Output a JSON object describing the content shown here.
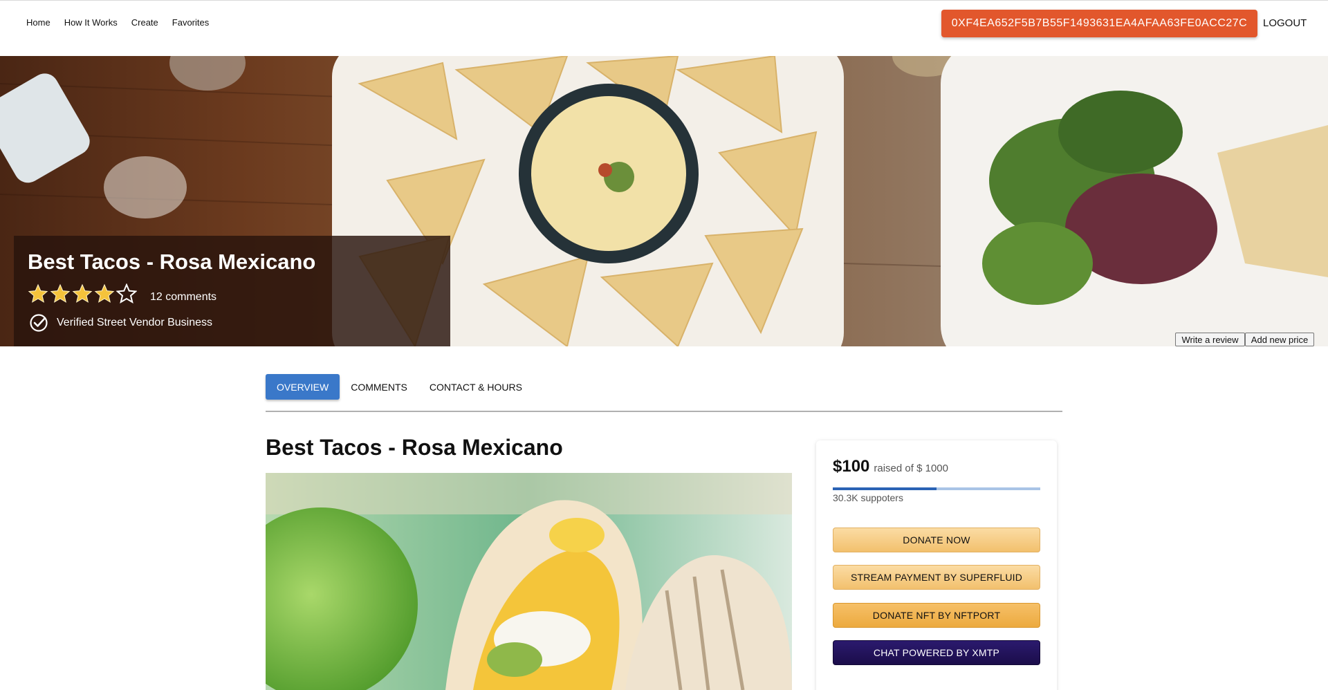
{
  "nav": {
    "links": [
      "Home",
      "How It Works",
      "Create",
      "Favorites"
    ],
    "wallet_address": "0XF4EA652F5B7B55F1493631EA4AFAA63FE0ACC27C",
    "logout_label": "LOGOUT"
  },
  "hero": {
    "title": "Best Tacos - Rosa Mexicano",
    "rating": {
      "filled": 4,
      "max": 5
    },
    "comments_label": "12 comments",
    "verified_label": "Verified Street Vendor Business",
    "write_review_label": "Write a review",
    "add_price_label": "Add new price"
  },
  "tabs": [
    "OVERVIEW",
    "COMMENTS",
    "CONTACT & HOURS"
  ],
  "main": {
    "title": "Best Tacos - Rosa Mexicano"
  },
  "fund": {
    "raised": "$100",
    "goal_text": "raised of $ 1000",
    "progress_fraction": 0.5,
    "supporters": "30.3K suppoters",
    "buttons": {
      "donate": "DONATE NOW",
      "stream": "STREAM PAYMENT BY SUPERFLUID",
      "nft": "DONATE NFT BY NFTPORT",
      "chat": "CHAT POWERED BY XMTP"
    }
  },
  "colors": {
    "wallet_button": "#e2572c",
    "tab_active": "#3a78c9",
    "progress_fill": "#2a63b5",
    "donate_button": "#f2c06d",
    "chat_button": "#1b0d4a"
  }
}
